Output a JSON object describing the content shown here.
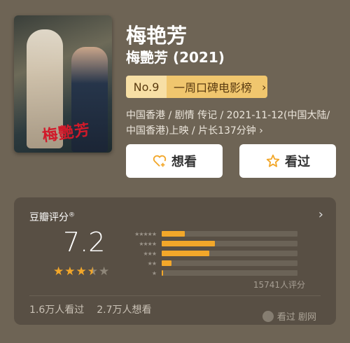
{
  "movie": {
    "title": "梅艳芳",
    "subtitle": "梅艷芳 (2021)",
    "poster_title": "梅艷芳",
    "rank": {
      "no": "No.9",
      "list": "一周口碑电影榜",
      "arrow": "›"
    },
    "meta": "中国香港 / 剧情 传记 / 2021-11-12(中国大陆/中国香港)上映 / 片长137分钟 ›"
  },
  "actions": {
    "want_label": "想看",
    "seen_label": "看过"
  },
  "rating": {
    "heading": "豆瓣评分",
    "mark": "®",
    "arrow": "›",
    "score": "7.2",
    "stars_value": 3.5,
    "distribution": [
      0.17,
      0.39,
      0.35,
      0.07,
      0.01
    ],
    "count": "15741人评分",
    "seen": "1.6万人看过",
    "want": "2.7万人想看"
  },
  "colors": {
    "accent": "#f2a72a",
    "rank_bg": "#f0c66e"
  },
  "watermark": {
    "label": "看过 剧网"
  }
}
